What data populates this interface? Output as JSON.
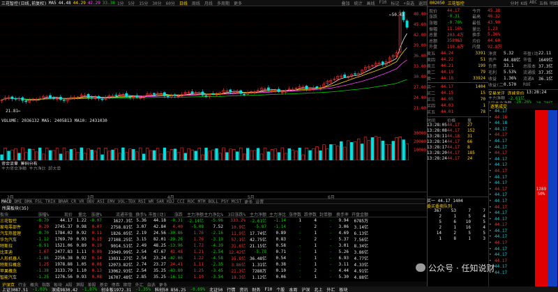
{
  "chart_toolbar": {
    "title": "三花智控(日线,前复权)",
    "ma_label": "MA5",
    "ma5": "44.48",
    "ma10": "44.29",
    "ma20": "42.29",
    "ma60": "33.38",
    "tabs": [
      "1分",
      "5分",
      "15分",
      "30分",
      "60分",
      "日线",
      "周线",
      "月线",
      "多周期",
      "更多"
    ],
    "right_items": [
      "叠加",
      "统计",
      "画线",
      "F10",
      "标记",
      "+自选",
      "返回"
    ]
  },
  "price_axis": [
    "48.00",
    "45.00",
    "42.00",
    "39.00",
    "36.00",
    "33.00",
    "30.00",
    "27.00",
    "24.00",
    "21.00"
  ],
  "price_annot": {
    "high": "50.43",
    "low": "21.81"
  },
  "volume_header": "VOLUME: 2036132  MA5: 2405813  MA10: 2431030",
  "volume_axis": [
    "30000",
    "20000",
    "10000"
  ],
  "capital_header": "资金流量  筹码分布",
  "capital_sub": "主力资金净额 主力净比 超大单",
  "time_axis": [
    "2月",
    "3月",
    "4月",
    "5月",
    "6月"
  ],
  "stock": {
    "code": "002050",
    "name": "三花智控",
    "fields": [
      [
        "现价",
        "44.17",
        "今开",
        "45.38"
      ],
      [
        "涨跌",
        "-0.31",
        "最高",
        "46.32"
      ],
      [
        "涨幅",
        "-0.70%",
        "最低",
        "43.90"
      ],
      [
        "振幅",
        "11.16%",
        "量比",
        "1.23"
      ],
      [
        "总量",
        "203.4万",
        "换手",
        "5.36%"
      ],
      [
        "总额",
        "358963",
        "均价",
        "44.60"
      ],
      [
        "外盘",
        "110.6万",
        "内盘",
        "92.8万"
      ]
    ]
  },
  "order_book": {
    "sells": [
      [
        "卖五",
        "44.24",
        "3391"
      ],
      [
        "卖四",
        "44.22",
        "51"
      ],
      [
        "卖三",
        "44.21",
        "199"
      ],
      [
        "卖二",
        "44.19",
        "79"
      ],
      [
        "卖一",
        "44.18",
        "33924"
      ]
    ],
    "buys": [
      [
        "买一",
        "44.17",
        "1404"
      ],
      [
        "买二",
        "44.15",
        "15"
      ],
      [
        "买三",
        "44.05",
        "70"
      ],
      [
        "买四",
        "44.03",
        "1"
      ],
      [
        "买五",
        "44.01",
        "78"
      ]
    ]
  },
  "fin": [
    [
      "净资",
      "5.32",
      "市盈(动)",
      "22.11"
    ],
    [
      "资产",
      "44.88亿",
      "市值",
      "1649亿"
    ],
    [
      "负债",
      "33.1",
      "总股本",
      "37.3亿"
    ],
    [
      "毛利",
      "5.53%",
      "流通股",
      "37.3亿"
    ],
    [
      "收益",
      "1.36%",
      "流通A",
      "36.1亿"
    ],
    [
      "收益(二)",
      "0.570",
      "ROE",
      "—"
    ]
  ],
  "flow": {
    "title": "交易关注  连续竞价",
    "time": "13:28:24",
    "main_label": "主力净额",
    "main_val": "-2.61亿",
    "big_label": "5日主力净额",
    "big_val": "-26.26%",
    "big_val2": "-28.78亿"
  },
  "tick_list": {
    "header": [
      "时间",
      "价格",
      "量"
    ],
    "rows": [
      [
        "13:28:05",
        "44.17",
        "27"
      ],
      [
        "13:28:08",
        "44.17",
        "152"
      ],
      [
        "13:28:11",
        "44.18",
        "31"
      ],
      [
        "13:28:14",
        "44.17",
        "66"
      ],
      [
        "13:28:17",
        "44.17",
        "8"
      ],
      [
        "13:28:20",
        "44.17",
        "185"
      ],
      [
        "13:28:24",
        "44.17",
        "24"
      ]
    ]
  },
  "l2": {
    "title": "逐笔成交",
    "price_col": "44.17",
    "rows": [
      "44.17",
      "44.18",
      "44.18",
      "44.17",
      "44.17",
      "44.17",
      "44.17",
      "44.17",
      "44.17",
      "44.17",
      "44.17",
      "44.17",
      "44.17",
      "44.17",
      "44.17",
      "44.17",
      "44.17",
      "44.17",
      "44.17",
      "44.17",
      "44.17",
      "44.17",
      "44.17",
      "44.17",
      "44.17",
      "44.17",
      "44.17",
      "44.17"
    ],
    "big_vol": "1289",
    "big_pct": "50%"
  },
  "queue": {
    "sell1": "卖一  44.18  33924",
    "sell1_b": "33924",
    "buy1": "买一  44.17  1404",
    "buy_label": "主买",
    "queue_title": "委买委卖队列",
    "bq": [
      [
        "367",
        "53",
        "7",
        "7"
      ],
      [
        "2",
        "1",
        "5",
        "4"
      ],
      [
        "5",
        "6",
        "10",
        "5"
      ],
      [
        "2",
        "1",
        "16",
        "4"
      ],
      [
        "14",
        "2",
        "5",
        "5"
      ],
      [
        "1",
        "8",
        "1",
        "3"
      ]
    ]
  },
  "indicators": [
    "MACD",
    "DMI",
    "DMA",
    "FSL",
    "TRIX",
    "BRAR",
    "CR",
    "VR",
    "OBV",
    "ASI",
    "EMV",
    "VOL-TDX",
    "RSI",
    "WR",
    "SAR",
    "KDJ",
    "CCI",
    "ROC",
    "MTM",
    "BOLL",
    "PSY",
    "MCST",
    "更多",
    "设置"
  ],
  "sector": {
    "title": "所属板块(35)",
    "headers": [
      "板块",
      "涨幅%",
      "现价",
      "量比",
      "涨速%",
      "流通市值",
      "换手%",
      "市盈(动)",
      "涨跌",
      "主力净额",
      "主力净比%",
      "3日涨跌%",
      "主力净额",
      "主力净比",
      "涨停数",
      "跌停数",
      "封单额",
      "换手率",
      "开盘金额"
    ],
    "rows": [
      [
        "三花智控",
        "-0.70",
        "44.17",
        "1.22",
        "-0.07",
        "1627.3亿",
        "5.36",
        "44.18",
        "-0.31",
        "-2.14亿",
        "-5.96",
        "333.2%",
        "-2.61亿",
        "-1.14",
        "1",
        "4",
        "-",
        "9.94",
        "6785万"
      ],
      [
        "家电零部件",
        "0.20",
        "2745.37",
        "0.98",
        "0.07",
        "2758.81亿",
        "3.07",
        "42.84",
        "4.40",
        "-5.08",
        "7.52",
        "10.9亿",
        "-5.87",
        "-1.14",
        "-",
        "2",
        "-",
        "3.06",
        "3.14亿"
      ],
      [
        "汽车热管理",
        "-0.70",
        "1784.02",
        "0.92",
        "0.11",
        "1826.05亿",
        "2.19",
        "24.56",
        "-30.86",
        "1.76",
        "-2.16",
        "11.9亿",
        "17.74亿",
        "0.89",
        "-",
        "1",
        "-",
        "4.69",
        "6.13亿"
      ],
      [
        "华为汽车",
        "-1.12",
        "1769.70",
        "0.93",
        "0.15",
        "27108.25亿",
        "3.15",
        "82.01",
        "-29.26",
        "1.76",
        "-3.19",
        "57.1亿",
        "42.75亿",
        "0.83",
        "-",
        "2",
        "-",
        "5.37",
        "7.56亿"
      ],
      [
        "特斯拉",
        "-0.91",
        "1521.06",
        "0.89",
        "0.19",
        "9014.51亿",
        "2.49",
        "48.25",
        "-13.96",
        "1.72",
        "-4.39",
        "31.6亿",
        "21.15亿",
        "0.58",
        "-",
        "1",
        "-",
        "3.01",
        "8.34亿"
      ],
      [
        "比亚迪",
        "1.67",
        "2477.83",
        "1.11",
        "0.00",
        "23049.99亿",
        "2.54",
        "47.67",
        "41.48",
        "1.21",
        "-2.54",
        "12.42亿",
        "-5.78",
        "0.71",
        "-",
        "1",
        "-",
        "5.26",
        "3.86亿"
      ],
      [
        "人形机器人",
        "-1.86",
        "2256.38",
        "0.92",
        "0.14",
        "13031.27亿",
        "2.54",
        "23.24",
        "-42.06",
        "1.22",
        "-4.58",
        "35.6亿",
        "36.48亿",
        "0.54",
        "-",
        "1",
        "-",
        "6.93",
        "4.77亿"
      ],
      [
        "特斯拉概念",
        "1.25",
        "1978.88",
        "1.05",
        "0.06",
        "12073.82亿",
        "2.74",
        "23.27",
        "24.41",
        "1.11",
        "-2.35",
        "3.86亿",
        "1.31亿",
        "0.38",
        "-",
        "1",
        "-",
        "3.11",
        "4.33亿"
      ],
      [
        "苹果概念",
        "-1.38",
        "3133.79",
        "1.10",
        "0.13",
        "13062.93亿",
        "2.54",
        "35.25",
        "-43.80",
        "1.25",
        "-3.45",
        "21.3亿",
        "7288万",
        "0.10",
        "-",
        "2",
        "-",
        "4.44",
        "4.91亿"
      ],
      [
        "智能汽车",
        "-1.25",
        "1276.56",
        "0.93",
        "0.08",
        "16707.48亿",
        "2.85",
        "35.25",
        "-16.12",
        "1.10",
        "-3.54",
        "18.3亿",
        "1.12亿",
        "0.06",
        "-",
        "1",
        "-",
        "5.30",
        "4.88亿"
      ]
    ]
  },
  "bottom_tabs": [
    "沪深京",
    "行业",
    "概念",
    "指数",
    "板块",
    "A股",
    "港股",
    "美股",
    "基金",
    "债券",
    "期货",
    "外汇",
    "自选",
    "更多"
  ],
  "status_bar": [
    "上证3087.51",
    "-1.03%",
    "深成9830.42",
    "-1.87%",
    "创业板1972.31",
    "-1.35%",
    "科创50 856.25",
    "-0.69%",
    "北证50",
    "行情",
    "资讯",
    "财务",
    "F10",
    "个股",
    "本周",
    "沪深",
    "北上",
    "外汇",
    "板块"
  ],
  "watermark": "公众号 · 任知说财",
  "right_tabs": [
    "分时",
    "K线",
    "ABC",
    "五档",
    "明细"
  ]
}
